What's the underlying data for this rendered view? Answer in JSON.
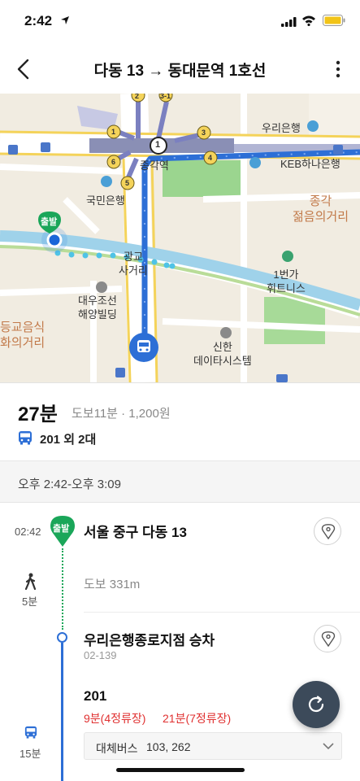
{
  "status": {
    "time": "2:42"
  },
  "header": {
    "title": "다동 13 → 동대문역 1호선"
  },
  "map": {
    "labels": {
      "woori": "우리은행",
      "keb": "KEB하나은행",
      "jonggak_station": "종각역",
      "kookmin": "국민은행",
      "jonggak_youth": "종각\n젊음의거리",
      "start_badge": "출발",
      "gwanggyo": "광교\n사거리",
      "first_ave": "1번가\n휘트니스",
      "daewoo": "대우조선\n해양빌딩",
      "food_street": "등교음식\n화의거리",
      "shinhan": "신한\n데이타시스템"
    },
    "exits": [
      "2",
      "3-1",
      "1",
      "3",
      "6",
      "4",
      "5"
    ],
    "station_number": "1"
  },
  "summary": {
    "duration": "27분",
    "detail": "도보11분 · 1,200원",
    "bus": "201 외 2대"
  },
  "time_range": "오후 2:42-오후 3:09",
  "timeline": {
    "start_time": "02:42",
    "start_badge": "출발",
    "origin": "서울 중구 다동 13",
    "walk_minutes": "5분",
    "walk_text": "도보 331m",
    "stop_name": "우리은행종로지점 승차",
    "stop_id": "02-139",
    "bus_route": "201",
    "arrival_1": "9분(4정류장)",
    "arrival_2": "21분(7정류장)",
    "bus_minutes": "15분",
    "alt_label": "대체버스",
    "alt_values": "103, 262"
  },
  "colors": {
    "route_blue": "#2d6fd6",
    "walk_green": "#1aa659",
    "alert_red": "#e03131",
    "fab_dark": "#3c4a5a"
  }
}
